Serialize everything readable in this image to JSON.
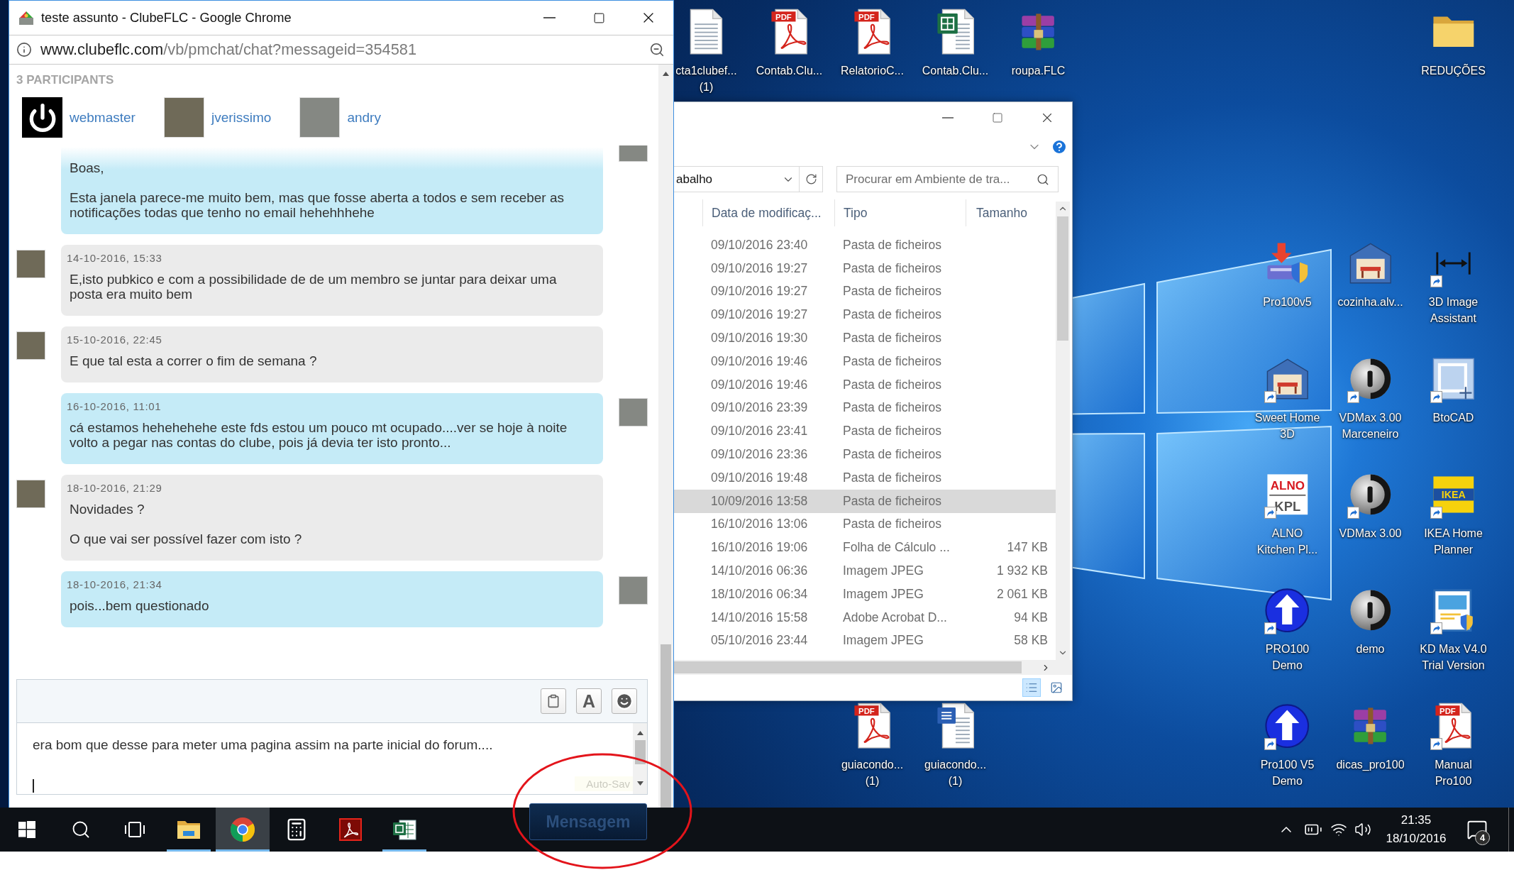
{
  "chat_window": {
    "title": "teste assunto - ClubeFLC - Google Chrome",
    "url": {
      "host": "www.clubeflc.com",
      "path": "/vb/pmchat/chat?messageid=354581"
    },
    "participants_heading": "3 PARTICIPANTS",
    "participants": [
      {
        "name": "webmaster",
        "kind": "power"
      },
      {
        "name": "jverissimo",
        "kind": "photo"
      },
      {
        "name": "andry",
        "kind": "photo"
      }
    ],
    "messages": [
      {
        "own": true,
        "text": "Boas,\n\nEsta janela parece-me muito bem, mas que fosse aberta a todos e sem receber as\nnotificações todas que tenho no email hehehhhehe"
      },
      {
        "own": false,
        "date": "14-10-2016, 15:33",
        "text": "E,isto pubkico e com a possibilidade de de um membro se juntar para deixar uma\nposta era muito bem"
      },
      {
        "own": false,
        "date": "15-10-2016, 22:45",
        "text": "E que tal esta a correr o fim de semana ?"
      },
      {
        "own": true,
        "date": "16-10-2016, 11:01",
        "text": "cá estamos hehehehehe este fds estou um pouco mt ocupado....ver se hoje à noite\nvolto a pegar nas contas do clube, pois já devia ter isto pronto..."
      },
      {
        "own": false,
        "date": "18-10-2016, 21:29",
        "text": "Novidades ?\n\nO que vai ser possível fazer com isto ?"
      },
      {
        "own": true,
        "date": "18-10-2016, 21:34",
        "text": "pois...bem questionado"
      }
    ],
    "compose": {
      "tools": [
        {
          "kind": "attach"
        },
        {
          "kind": "font",
          "label": "A"
        },
        {
          "kind": "emoji"
        }
      ],
      "value": "era bom que desse para meter uma pagina assim na parte inicial do forum....",
      "autosave": "Auto-Sav",
      "send_button": "Mensagem"
    }
  },
  "desktop_icons": [
    {
      "label": "cta1clubef...\n(1)",
      "kind": "text-document",
      "shortcut": false
    },
    {
      "label": "Contab.Clu...",
      "kind": "pdf",
      "icon_text": [
        "PDF"
      ],
      "shortcut": false
    },
    {
      "label": "RelatorioC...",
      "kind": "pdf",
      "icon_text": [
        "PDF"
      ],
      "shortcut": false
    },
    {
      "label": "Contab.Clu...",
      "kind": "spreadsheet",
      "shortcut": false
    },
    {
      "label": "roupa.FLC",
      "kind": "archive",
      "shortcut": false
    },
    {
      "label": "REDUÇÕES",
      "kind": "folder",
      "shortcut": false
    },
    {
      "label": "Pro100v5",
      "kind": "installer",
      "shortcut": false
    },
    {
      "label": "cozinha.alv...",
      "kind": "house",
      "shortcut": false
    },
    {
      "label": "3D Image\nAssistant",
      "kind": "dimension",
      "shortcut": true
    },
    {
      "label": "Sweet Home\n3D",
      "kind": "house",
      "shortcut": true
    },
    {
      "label": "VDMax 3.00\nMarceneiro",
      "kind": "disc",
      "shortcut": true
    },
    {
      "label": "BtoCAD",
      "kind": "cad",
      "shortcut": true
    },
    {
      "label": "ALNO\nKitchen Pl...",
      "kind": "alno",
      "icon_text": [
        "ALNO",
        "KPL"
      ],
      "shortcut": true
    },
    {
      "label": "VDMax 3.00",
      "kind": "disc",
      "shortcut": true
    },
    {
      "label": "IKEA Home\nPlanner",
      "kind": "ikea",
      "icon_text": [
        "IKEA"
      ],
      "shortcut": true
    },
    {
      "label": "PRO100\nDemo",
      "kind": "upload-arrow",
      "shortcut": true
    },
    {
      "label": "demo",
      "kind": "disc",
      "shortcut": false
    },
    {
      "label": "KD Max V4.0\nTrial Version",
      "kind": "kdmax",
      "shortcut": true
    },
    {
      "label": "guiacondo...\n(1)",
      "kind": "pdf",
      "icon_text": [
        "PDF"
      ],
      "shortcut": false
    },
    {
      "label": "guiacondo...\n(1)",
      "kind": "word-document",
      "shortcut": false
    },
    {
      "label": "Pro100 V5\nDemo",
      "kind": "upload-arrow",
      "shortcut": true
    },
    {
      "label": "dicas_pro100",
      "kind": "archive",
      "shortcut": false
    },
    {
      "label": "Manual\nPro100",
      "kind": "pdf",
      "icon_text": [
        "PDF"
      ],
      "shortcut": true
    }
  ],
  "explorer_window": {
    "address_value": "abalho",
    "search": {
      "placeholder": "Procurar em Ambiente de tra..."
    },
    "columns": [
      "Data de modificaç...",
      "Tipo",
      "Tamanho"
    ],
    "rows": [
      {
        "date": "09/10/2016 23:40",
        "type": "Pasta de ficheiros",
        "selected": false
      },
      {
        "date": "09/10/2016 19:27",
        "type": "Pasta de ficheiros",
        "selected": false
      },
      {
        "date": "09/10/2016 19:27",
        "type": "Pasta de ficheiros",
        "selected": false
      },
      {
        "date": "09/10/2016 19:27",
        "type": "Pasta de ficheiros",
        "selected": false
      },
      {
        "date": "09/10/2016 19:30",
        "type": "Pasta de ficheiros",
        "selected": false
      },
      {
        "date": "09/10/2016 19:46",
        "type": "Pasta de ficheiros",
        "selected": false
      },
      {
        "date": "09/10/2016 19:46",
        "type": "Pasta de ficheiros",
        "selected": false
      },
      {
        "date": "09/10/2016 23:39",
        "type": "Pasta de ficheiros",
        "selected": false
      },
      {
        "date": "09/10/2016 23:41",
        "type": "Pasta de ficheiros",
        "selected": false
      },
      {
        "date": "09/10/2016 23:36",
        "type": "Pasta de ficheiros",
        "selected": false
      },
      {
        "date": "09/10/2016 19:48",
        "type": "Pasta de ficheiros",
        "selected": false
      },
      {
        "date": "10/09/2016 13:58",
        "type": "Pasta de ficheiros",
        "selected": true
      },
      {
        "date": "16/10/2016 13:06",
        "type": "Pasta de ficheiros",
        "selected": false
      },
      {
        "date": "16/10/2016 19:06",
        "type": "Folha de Cálculo ...",
        "size": "147 KB",
        "selected": false
      },
      {
        "date": "14/10/2016 06:36",
        "type": "Imagem JPEG",
        "size": "1 932 KB",
        "selected": false
      },
      {
        "date": "18/10/2016 06:34",
        "type": "Imagem JPEG",
        "size": "2 061 KB",
        "selected": false
      },
      {
        "date": "14/10/2016 15:58",
        "type": "Adobe Acrobat D...",
        "size": "94 KB",
        "selected": false
      },
      {
        "date": "05/10/2016 23:44",
        "type": "Imagem JPEG",
        "size": "58 KB",
        "selected": false
      }
    ],
    "views": [
      {
        "kind": "details",
        "selected": true
      },
      {
        "kind": "large-icons",
        "selected": false
      }
    ]
  },
  "taskbar": {
    "buttons": [
      {
        "kind": "start",
        "running": false,
        "active": false
      },
      {
        "kind": "search",
        "running": false,
        "active": false
      },
      {
        "kind": "taskview",
        "running": false,
        "active": false
      },
      {
        "kind": "files",
        "running": true,
        "active": false
      },
      {
        "kind": "browser",
        "running": true,
        "active": true
      },
      {
        "kind": "calculator",
        "running": false,
        "active": false
      },
      {
        "kind": "pdf",
        "running": false,
        "active": false
      },
      {
        "kind": "spreadsheet",
        "running": true,
        "active": false
      }
    ],
    "clock": {
      "time": "21:35",
      "date": "18/10/2016"
    },
    "notifications": "4"
  }
}
